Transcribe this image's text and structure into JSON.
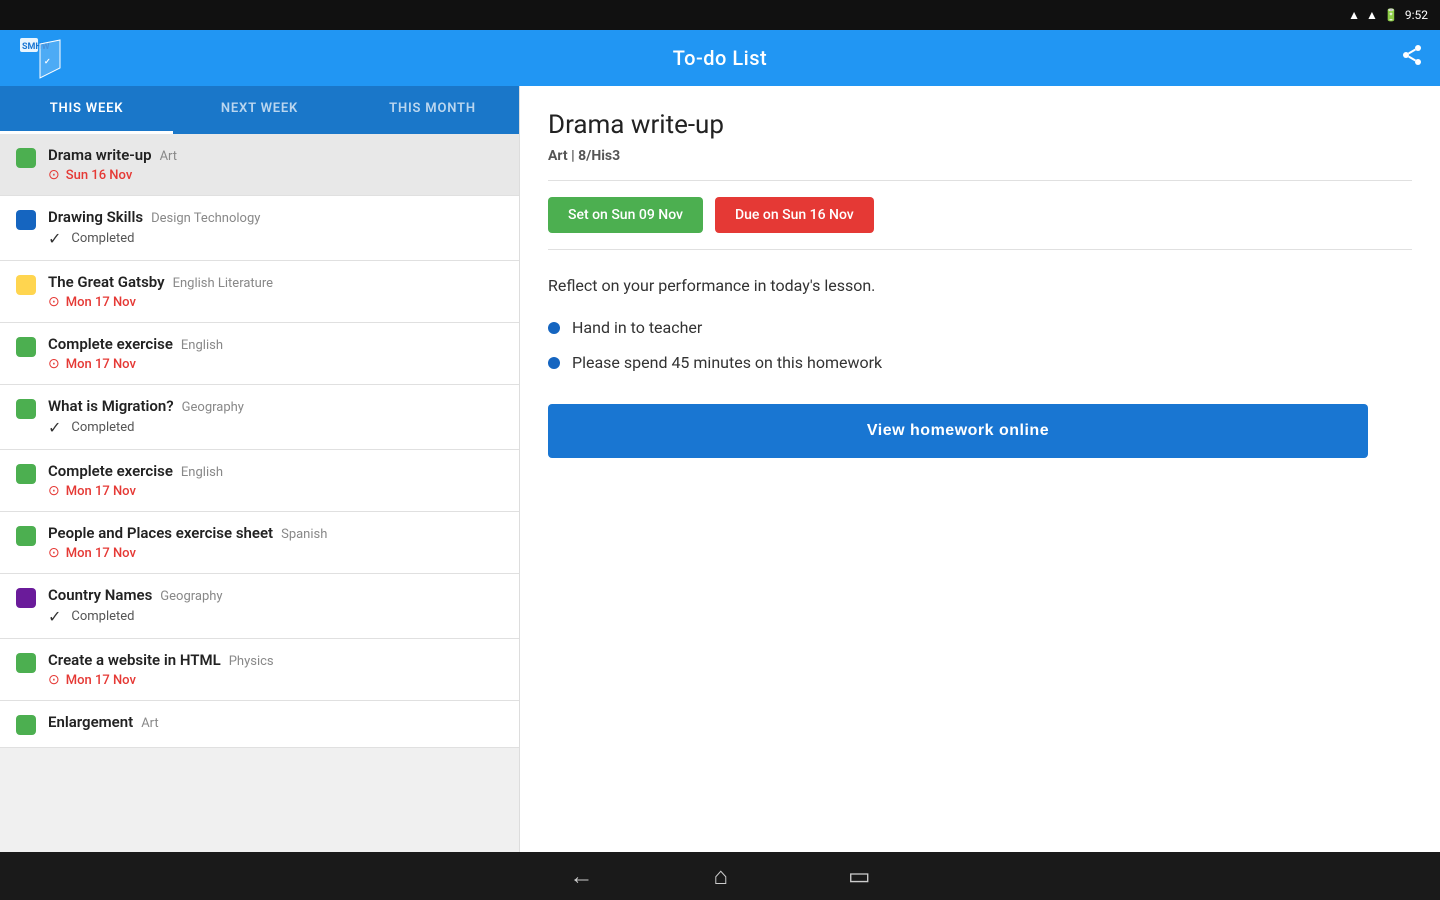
{
  "statusBar": {
    "time": "9:52",
    "wifiIcon": "wifi",
    "signalIcon": "signal",
    "batteryIcon": "battery"
  },
  "appBar": {
    "title": "To-do List",
    "logoText": "SMHW",
    "shareIcon": "share"
  },
  "tabs": [
    {
      "id": "this-week",
      "label": "THIS WEEK",
      "active": true
    },
    {
      "id": "next-week",
      "label": "NEXT WEEK",
      "active": false
    },
    {
      "id": "this-month",
      "label": "THIS MONTH",
      "active": false
    }
  ],
  "tasks": [
    {
      "id": 1,
      "title": "Drama write-up",
      "subject": "Art",
      "color": "#4CAF50",
      "dueType": "date",
      "due": "Sun 16 Nov",
      "selected": true
    },
    {
      "id": 2,
      "title": "Drawing Skills",
      "subject": "Design Technology",
      "color": "#1565C0",
      "dueType": "completed",
      "due": "Completed",
      "selected": false
    },
    {
      "id": 3,
      "title": "The Great Gatsby",
      "subject": "English Literature",
      "color": "#FFD54F",
      "dueType": "date",
      "due": "Mon 17 Nov",
      "selected": false
    },
    {
      "id": 4,
      "title": "Complete exercise",
      "subject": "English",
      "color": "#4CAF50",
      "dueType": "date",
      "due": "Mon 17 Nov",
      "selected": false
    },
    {
      "id": 5,
      "title": "What is Migration?",
      "subject": "Geography",
      "color": "#4CAF50",
      "dueType": "completed",
      "due": "Completed",
      "selected": false
    },
    {
      "id": 6,
      "title": "Complete exercise",
      "subject": "English",
      "color": "#4CAF50",
      "dueType": "date",
      "due": "Mon 17 Nov",
      "selected": false
    },
    {
      "id": 7,
      "title": "People and Places exercise sheet",
      "subject": "Spanish",
      "color": "#4CAF50",
      "dueType": "date",
      "due": "Mon 17 Nov",
      "selected": false
    },
    {
      "id": 8,
      "title": "Country Names",
      "subject": "Geography",
      "color": "#6A1B9A",
      "dueType": "completed",
      "due": "Completed",
      "selected": false
    },
    {
      "id": 9,
      "title": "Create a website in HTML",
      "subject": "Physics",
      "color": "#4CAF50",
      "dueType": "date",
      "due": "Mon 17 Nov",
      "selected": false
    },
    {
      "id": 10,
      "title": "Enlargement",
      "subject": "Art",
      "color": "#4CAF50",
      "dueType": "partial",
      "due": "",
      "selected": false
    }
  ],
  "detail": {
    "title": "Drama write-up",
    "subtitle": "Art | 8/His3",
    "setDate": "Set on Sun 09 Nov",
    "dueDate": "Due on Sun 16 Nov",
    "description": "Reflect on your performance in today's lesson.",
    "bullets": [
      "Hand in to teacher",
      "Please spend 45 minutes on this homework"
    ],
    "viewButtonLabel": "View homework online"
  },
  "bottomNav": {
    "backIcon": "←",
    "homeIcon": "⌂",
    "recentIcon": "▭"
  }
}
